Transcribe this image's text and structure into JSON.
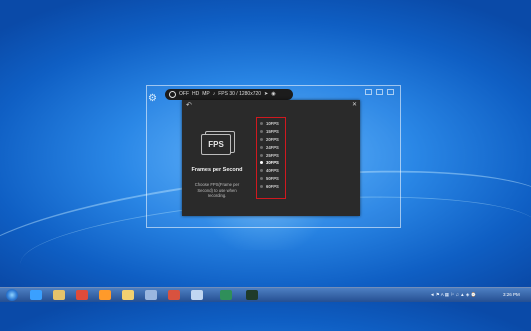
{
  "toolbar": {
    "record_label": "OFF",
    "hd_label": "HD",
    "cam_label": "MP",
    "music_icon": "music-note-icon",
    "fps_status": "FPS 30 / 1280x720",
    "cursor_icon": "cursor-icon",
    "record_icon": "record-icon"
  },
  "panel": {
    "back_icon": "back-arrow-icon",
    "logo_text": "FPS",
    "title": "Frames per Second",
    "description": "Choose FPS(Frame per Second) to use when recording.",
    "fps_options": [
      "10FPS",
      "15FPS",
      "20FPS",
      "24FPS",
      "25FPS",
      "30FPS",
      "40FPS",
      "50FPS",
      "60FPS"
    ],
    "selected": "30FPS"
  },
  "taskbar": {
    "icons": [
      "start-orb-icon",
      "ie-icon",
      "explorer-icon",
      "chrome-icon",
      "firefox-icon",
      "folder-icon",
      "media-icon",
      "chrome-icon-2",
      "window-icon",
      "photoshop-icon",
      "app-icon"
    ],
    "clock": "3:26 PM",
    "tray": "◄ ⚑ A ▦ ⚐ ♫ ▲ ◈ ⌚"
  }
}
